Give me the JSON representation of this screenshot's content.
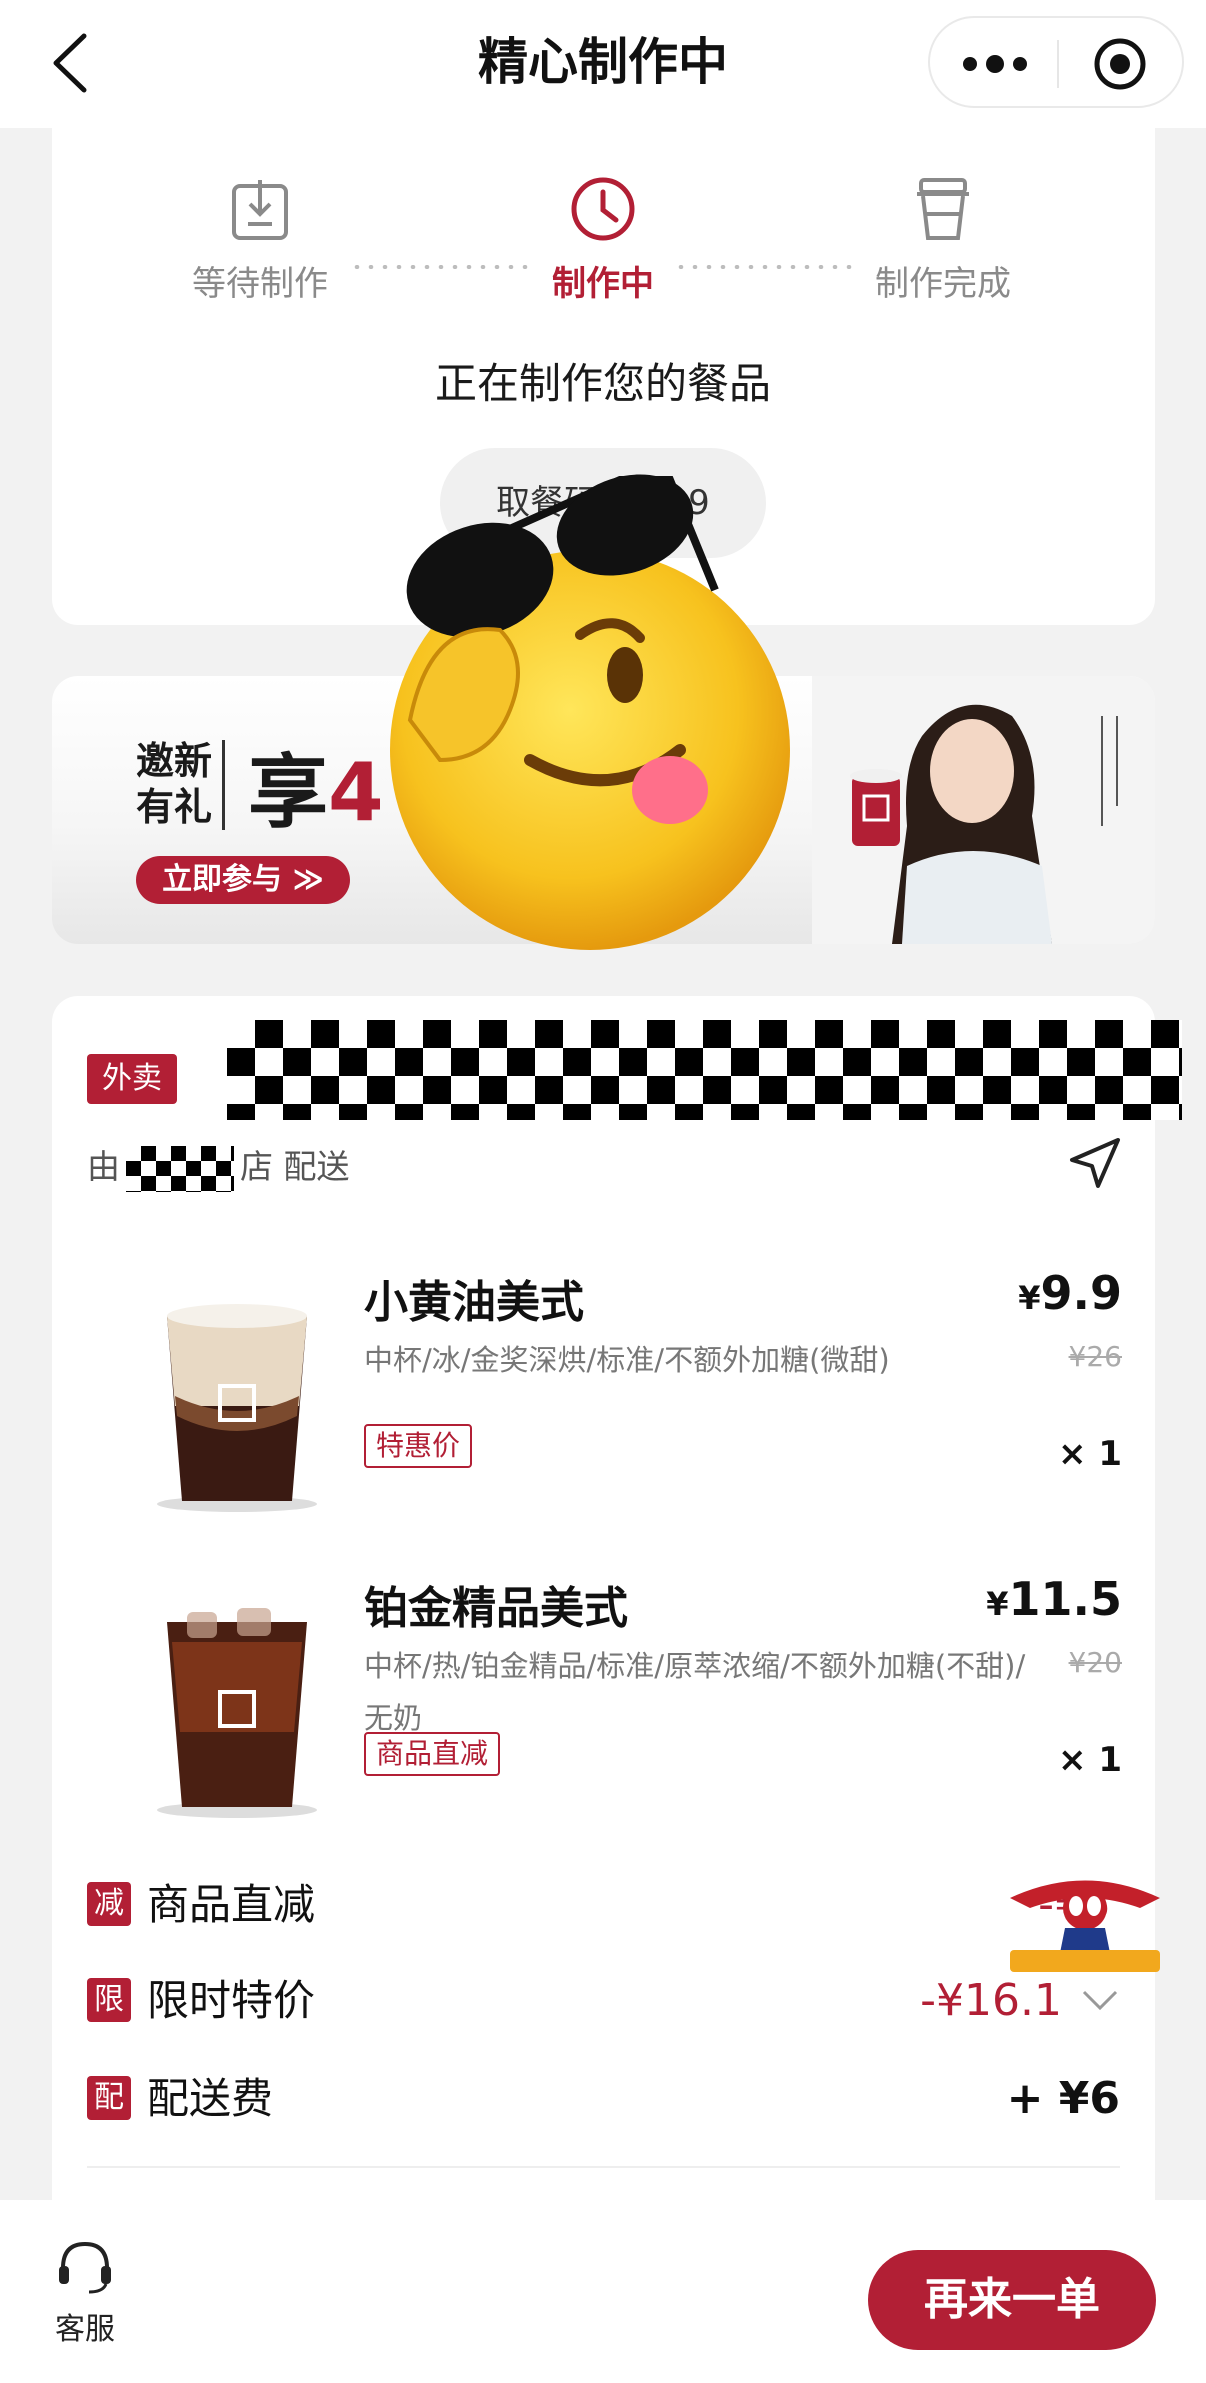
{
  "nav": {
    "title": "精心制作中"
  },
  "progress": {
    "steps": [
      {
        "label": "等待制作",
        "icon": "download-box-icon"
      },
      {
        "label": "制作中",
        "icon": "clock-icon"
      },
      {
        "label": "制作完成",
        "icon": "cup-icon"
      }
    ],
    "current_step": 1,
    "message": "正在制作您的餐品",
    "pickup_label": "取餐码",
    "pickup_code_suffix": "9"
  },
  "banner": {
    "invite_line1": "邀新",
    "invite_line2": "有礼",
    "headline_prefix": "享",
    "headline_red": "4",
    "join_label": "立即参与 ≫"
  },
  "order": {
    "type_tag": "外卖",
    "delivered_prefix": "由",
    "delivered_suffix": "店 配送",
    "items": [
      {
        "name": "小黄油美式",
        "desc": "中杯/冰/金奖深烘/标准/不额外加糖(微甜)",
        "tag": "特惠价",
        "price": "9.9",
        "currency": "¥",
        "orig_price": "¥26",
        "qty": "× 1"
      },
      {
        "name": "铂金精品美式",
        "desc": "中杯/热/铂金精品/标准/原萃浓缩/不额外加糖(不甜)/无奶",
        "tag": "商品直减",
        "price": "11.5",
        "currency": "¥",
        "orig_price": "¥20",
        "qty": "× 1"
      }
    ],
    "fees": [
      {
        "badge": "减",
        "label": "商品直减",
        "value": "-¥6"
      },
      {
        "badge": "限",
        "label": "限时特价",
        "value": "-¥16.1"
      },
      {
        "badge": "配",
        "label": "配送费",
        "value": "+ ¥6"
      }
    ]
  },
  "bottom": {
    "service_label": "客服",
    "reorder_label": "再来一单"
  },
  "colors": {
    "brand_red": "#b21f35",
    "background": "#f2f2f2"
  }
}
